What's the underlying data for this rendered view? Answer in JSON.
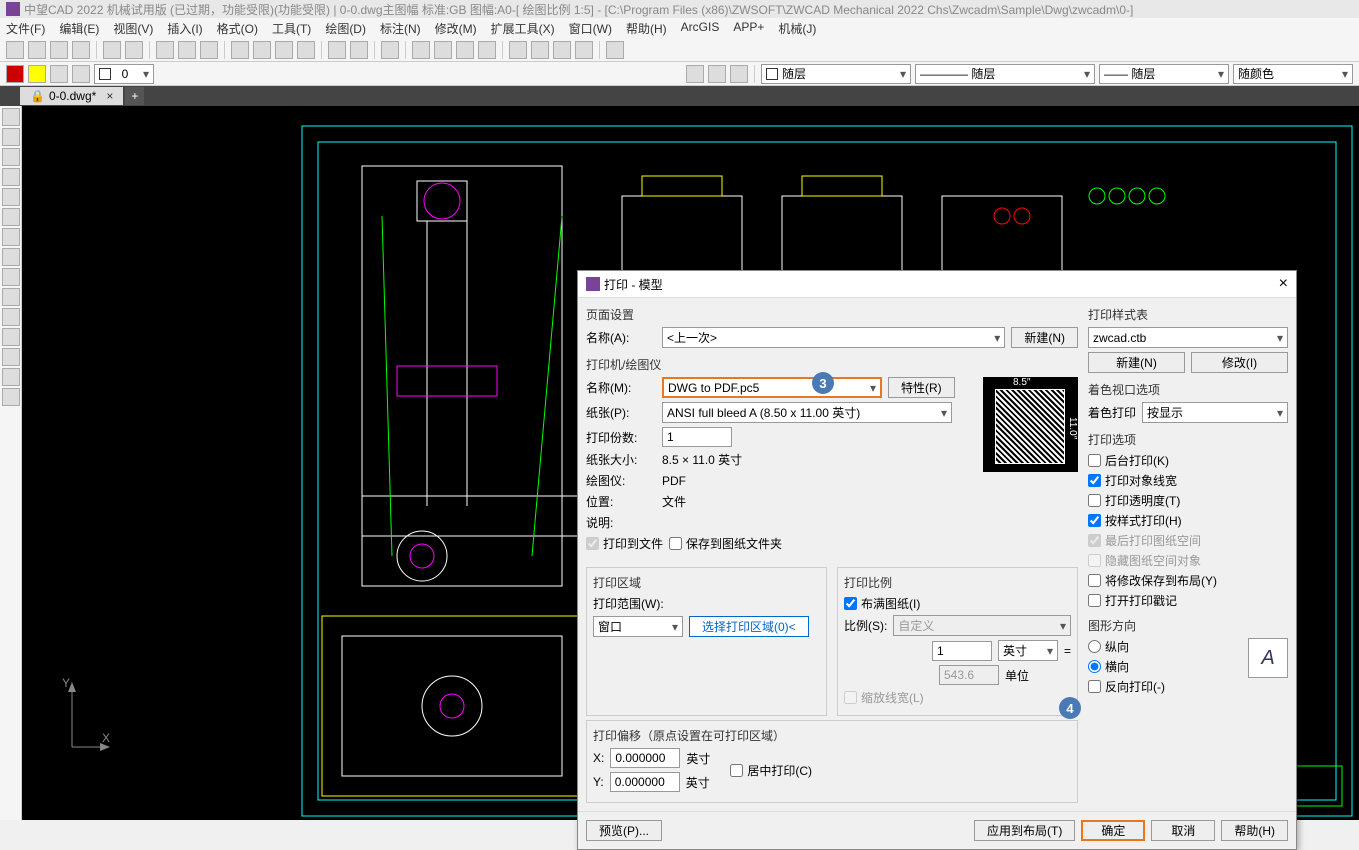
{
  "title": "中望CAD 2022 机械试用版 (已过期，功能受限)(功能受限) | 0-0.dwg主图幅  标准:GB 图幅:A0-[ 绘图比例 1:5] - [C:\\Program Files (x86)\\ZWSOFT\\ZWCAD Mechanical 2022 Chs\\Zwcadm\\Sample\\Dwg\\zwcadm\\0-]",
  "menu": [
    "文件(F)",
    "编辑(E)",
    "视图(V)",
    "插入(I)",
    "格式(O)",
    "工具(T)",
    "绘图(D)",
    "标注(N)",
    "修改(M)",
    "扩展工具(X)",
    "窗口(W)",
    "帮助(H)",
    "ArcGIS",
    "APP+",
    "机械(J)"
  ],
  "layer_dd": "随层",
  "ltype_dd": "随层",
  "lweight_dd": "随层",
  "color_dd": "随颜色",
  "tab_name": "0-0.dwg*",
  "dlg": {
    "title": "打印 - 模型",
    "page_setup": "页面设置",
    "name_lbl": "名称(A):",
    "name_val": "<上一次>",
    "new_btn": "新建(N)",
    "printer_grp": "打印机/绘图仪",
    "pname_lbl": "名称(M):",
    "pname_val": "DWG to PDF.pc5",
    "props_btn": "特性(R)",
    "paper_lbl": "纸张(P):",
    "paper_val": "ANSI full bleed A (8.50 x 11.00 英寸)",
    "copies_lbl": "打印份数:",
    "copies_val": "1",
    "psize_lbl": "纸张大小:",
    "psize_val": "8.5 × 11.0  英寸",
    "plotter_lbl": "绘图仪:",
    "plotter_val": "PDF",
    "loc_lbl": "位置:",
    "loc_val": "文件",
    "desc_lbl": "说明:",
    "tofile": "打印到文件",
    "tofolder": "保存到图纸文件夹",
    "area_grp": "打印区域",
    "what_lbl": "打印范围(W):",
    "what_val": "窗口",
    "pick_btn": "选择打印区域(0)<",
    "offset_grp": "打印偏移（原点设置在可打印区域）",
    "x_lbl": "X:",
    "x_val": "0.000000",
    "x_unit": "英寸",
    "y_lbl": "Y:",
    "y_val": "0.000000",
    "y_unit": "英寸",
    "center": "居中打印(C)",
    "scale_grp": "打印比例",
    "fit": "布满图纸(I)",
    "scale_lbl": "比例(S):",
    "scale_val": "自定义",
    "su1": "1",
    "su1u": "英寸",
    "eq": "=",
    "su2": "543.6",
    "su2u": "单位",
    "scalelw": "缩放线宽(L)",
    "style_grp": "打印样式表",
    "style_val": "zwcad.ctb",
    "style_new": "新建(N)",
    "style_mod": "修改(I)",
    "shade_grp": "着色视口选项",
    "shade_lbl": "着色打印",
    "shade_val": "按显示",
    "opt_grp": "打印选项",
    "opt_bg": "后台打印(K)",
    "opt_lw": "打印对象线宽",
    "opt_tr": "打印透明度(T)",
    "opt_st": "按样式打印(H)",
    "opt_ps": "最后打印图纸空间",
    "opt_hide": "隐藏图纸空间对象",
    "opt_save": "将修改保存到布局(Y)",
    "opt_stamp": "打开打印戳记",
    "orient_grp": "图形方向",
    "portrait": "纵向",
    "landscape": "横向",
    "upside": "反向打印(-)",
    "prev_w": "8.5″",
    "prev_h": "11.0″",
    "preview": "预览(P)...",
    "apply": "应用到布局(T)",
    "ok": "确定",
    "cancel": "取消",
    "help": "帮助(H)"
  }
}
